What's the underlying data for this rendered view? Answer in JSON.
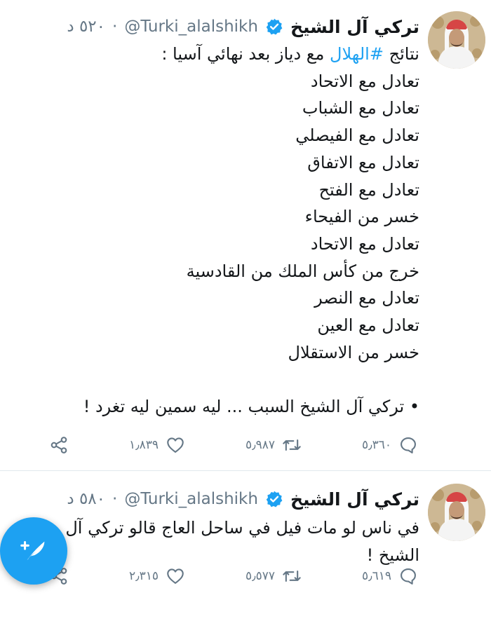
{
  "colors": {
    "accent": "#1da1f2",
    "muted": "#657786",
    "text": "#14171a",
    "divider": "#e1e8ed"
  },
  "tweets": [
    {
      "name": "تركي آل الشيخ",
      "handle": "@Turki_alalshikh",
      "time": "٥٢٠ د",
      "lines": [
        {
          "pre": "نتائج ",
          "hashtag": "#الهلال",
          "post": " مع دياز بعد نهائي آسيا :"
        },
        "تعادل مع الاتحاد",
        "تعادل مع الشباب",
        "تعادل مع الفيصلي",
        "تعادل مع الاتفاق",
        "تعادل مع الفتح",
        "خسر من الفيحاء",
        "تعادل مع الاتحاد",
        "خرج من كأس الملك من القادسية",
        "تعادل مع النصر",
        "تعادل مع العين",
        "خسر من الاستقلال",
        "",
        "• تركي آل الشيخ السبب ... ليه سمين ليه تغرد !"
      ],
      "replies": "٥٫٣٦٠",
      "retweets": "٥٫٩٨٧",
      "likes": "١٫٨٣٩",
      "icons": [
        "reply-icon",
        "retweet-icon",
        "like-icon",
        "share-icon"
      ]
    },
    {
      "name": "تركي آل الشيخ",
      "handle": "@Turki_alalshikh",
      "time": "٥٨٠ د",
      "lines": [
        "في ناس لو مات فيل في ساحل العاج قالو تركي آل الشيخ !"
      ],
      "replies": "٥٫٦١٩",
      "retweets": "٥٫٥٧٧",
      "likes": "٢٫٣١٥"
    }
  ],
  "fab": {
    "icon": "compose-tweet-icon"
  }
}
